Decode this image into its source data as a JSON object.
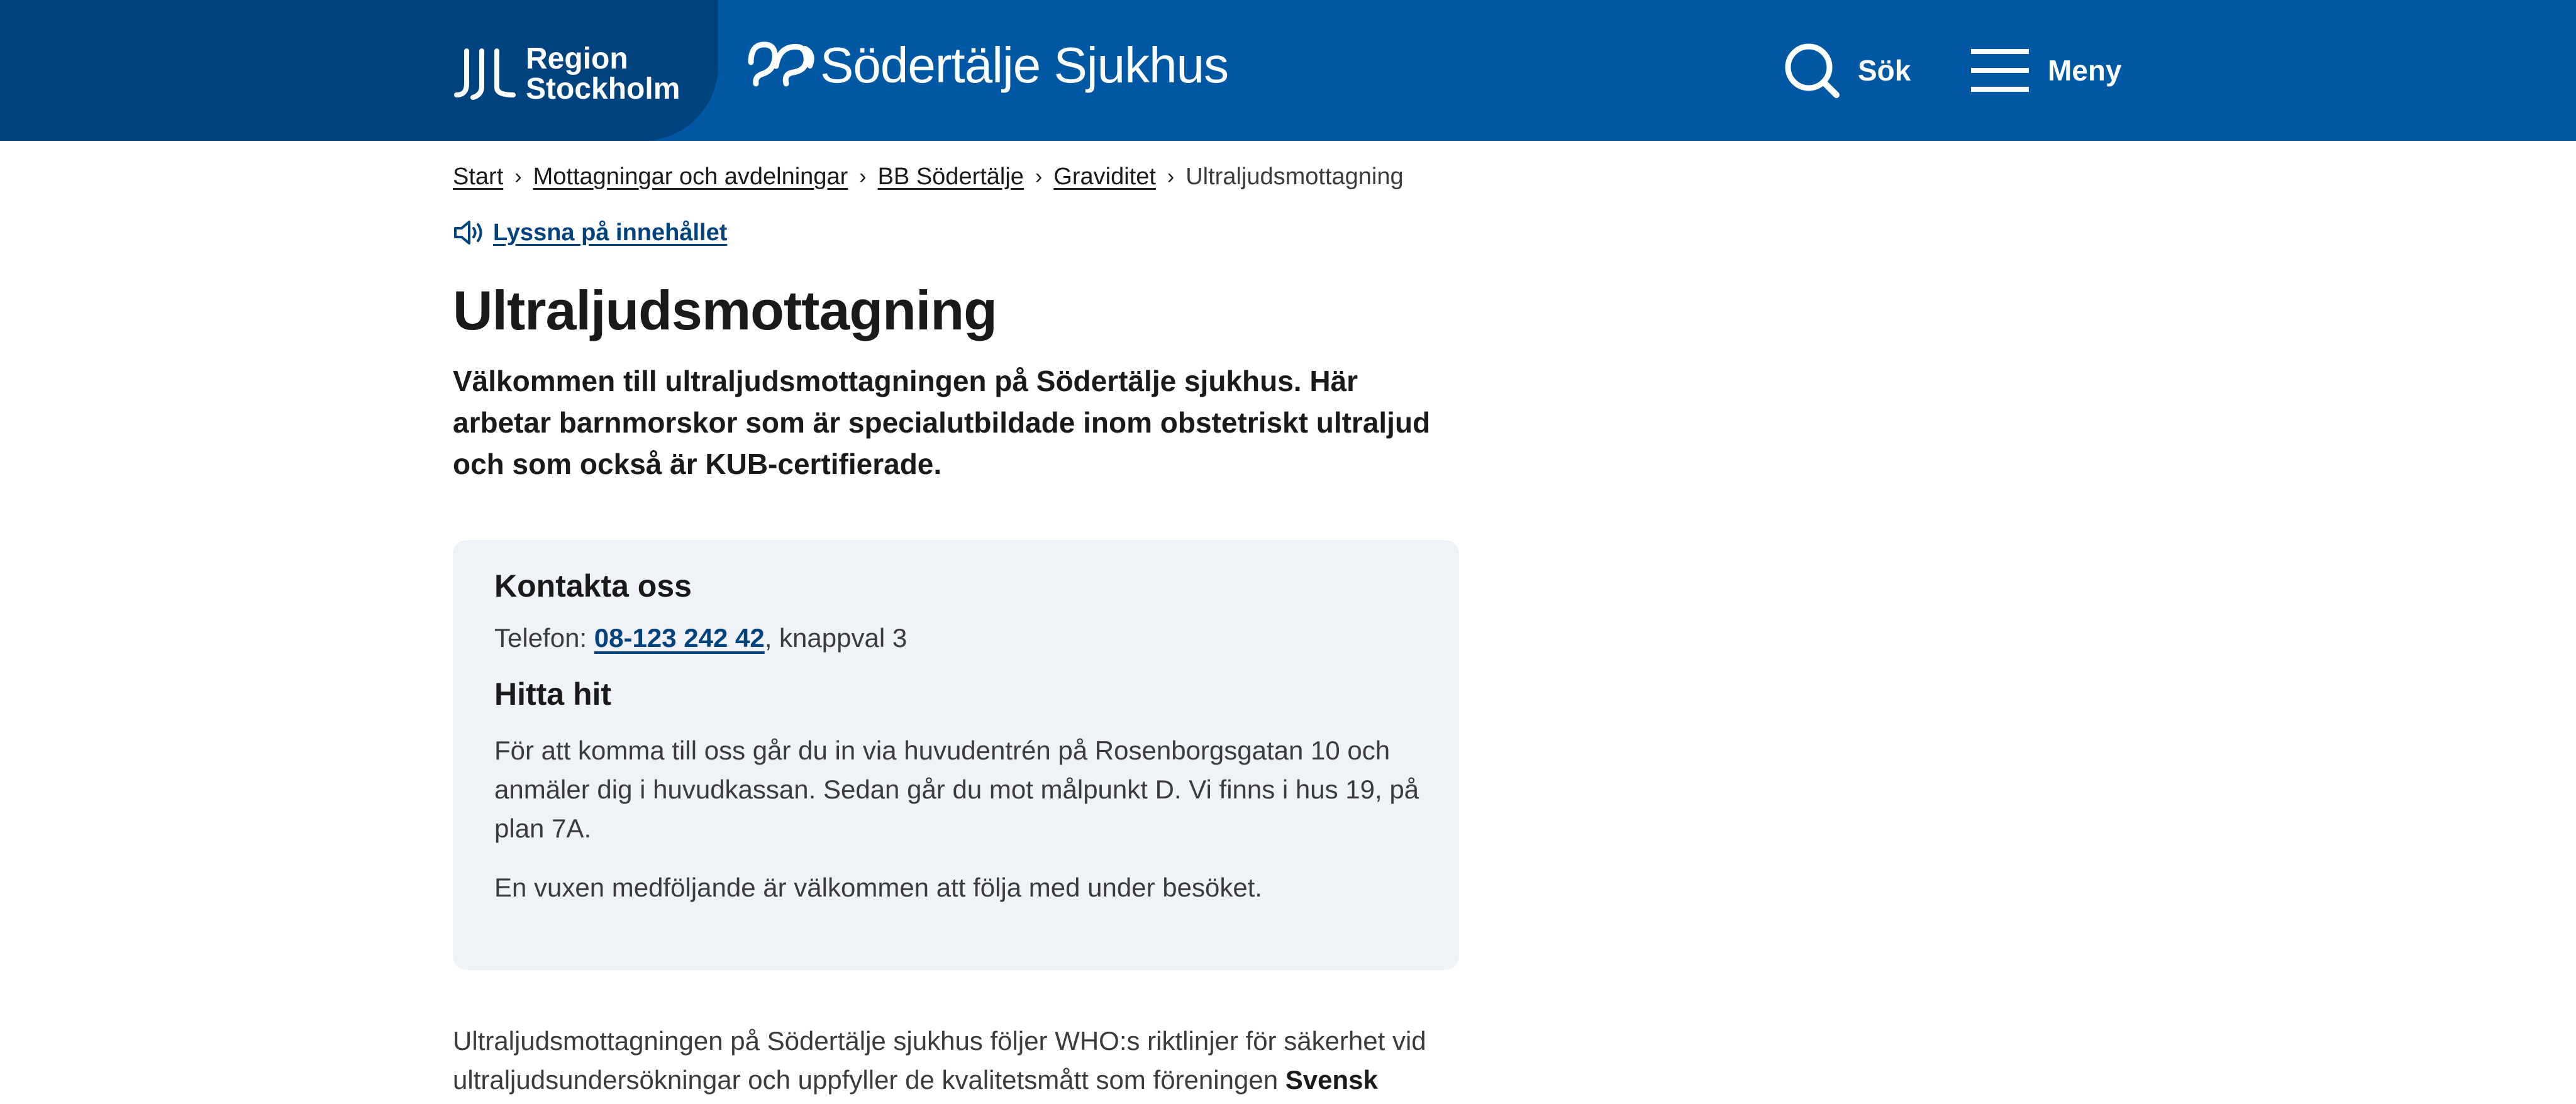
{
  "header": {
    "region_line1": "Region",
    "region_line2": "Stockholm",
    "hospital_name": "Södertälje Sjukhus",
    "search_label": "Sök",
    "menu_label": "Meny",
    "background_color": "#0057a4",
    "region_color": "#00427e"
  },
  "breadcrumb": {
    "items": [
      "Start",
      "Mottagningar och avdelningar",
      "BB Södertälje",
      "Graviditet"
    ],
    "current": "Ultraljudsmottagning"
  },
  "listen_label": "Lyssna på innehållet",
  "page_title": "Ultraljudsmottagning",
  "lead": "Välkommen till ultraljudsmottagningen på Södertälje sjukhus. Här arbetar barnmorskor som är specialutbildade inom obstetriskt ultraljud och som också är KUB-certifierade.",
  "contact": {
    "heading": "Kontakta oss",
    "phone_prefix": "Telefon: ",
    "phone_number": "08-123 242 42",
    "phone_suffix": ", knappval 3",
    "directions_heading": "Hitta hit",
    "directions": "För att komma till oss går du in via huvudentrén på Rosenborgsgatan 10 och anmäler dig i huvudkassan. Sedan går du mot målpunkt D. Vi finns i hus 19, på plan 7A.",
    "companion": "En vuxen medföljande är välkommen att följa med under besöket."
  },
  "body": {
    "text": "Ultraljudsmottagningen på Södertälje sjukhus följer WHO:s riktlinjer för säkerhet vid ultraljudsundersökningar och uppfyller de kvalitetsmått som föreningen ",
    "bold": "Svensk"
  },
  "icons": {
    "region_logo": "region-stockholm-logo",
    "hospital_logo": "sodertalje-sjukhus-logo",
    "search": "search-icon",
    "menu": "hamburger-menu-icon",
    "listen": "speaker-icon"
  }
}
